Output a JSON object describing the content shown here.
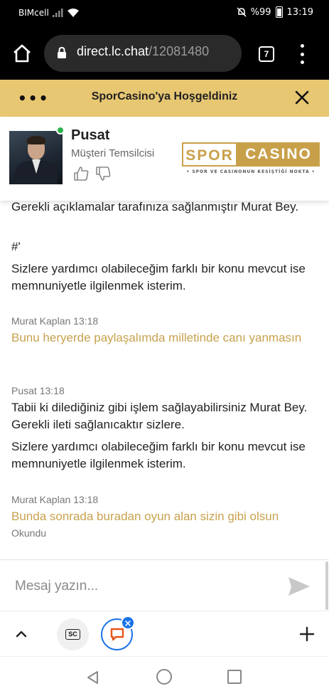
{
  "status_bar": {
    "carrier": "BIMcell",
    "battery": "%99",
    "time": "13:19",
    "icons": [
      "signal-icon",
      "wifi-icon",
      "mute-icon",
      "battery-icon"
    ]
  },
  "browser": {
    "url_host": "direct.lc.chat",
    "url_path": "/12081480",
    "tab_count": "7",
    "icons": [
      "home-icon",
      "lock-icon",
      "overflow-menu-icon"
    ]
  },
  "chat_header": {
    "more_label": "•••",
    "title": "SporCasino'ya Hoşgeldiniz",
    "accent_color": "#e8c773"
  },
  "agent": {
    "name": "Pusat",
    "role": "Müşteri Temsilcisi",
    "status_color": "#2bb24c"
  },
  "brand": {
    "word1": "SPOR",
    "word2": "CASINO",
    "tagline": "• SPOR VE CASINONUN KESİŞTİĞİ NOKTA •",
    "color": "#c9a04a"
  },
  "messages": [
    {
      "kind": "text",
      "text": "Gerekli açıklamalar tarafınıza sağlanmıştır Murat Bey."
    },
    {
      "kind": "text",
      "text": "#'"
    },
    {
      "kind": "text",
      "text": "Sizlere yardımcı olabileceğim farklı bir konu mevcut ise memnuniyetle ilgilenmek isterim."
    },
    {
      "kind": "meta",
      "text": "Murat Kaplan 13:18"
    },
    {
      "kind": "visitor",
      "text": "Bunu heryerde paylaşalımda milletinde canı yanmasın"
    },
    {
      "kind": "meta",
      "text": "Pusat 13:18"
    },
    {
      "kind": "text",
      "text": "Tabii ki dilediğiniz gibi işlem sağlayabilirsiniz Murat Bey. Gerekli ileti sağlanıcaktır sizlere."
    },
    {
      "kind": "text",
      "text": "Sizlere yardımcı olabileceğim farklı bir konu mevcut ise memnuniyetle ilgilenmek isterim."
    },
    {
      "kind": "meta",
      "text": "Murat Kaplan 13:18"
    },
    {
      "kind": "visitor",
      "text": "Bunda sonrada buradan oyun alan sizin gibi olsun"
    },
    {
      "kind": "status",
      "text": "Okundu"
    }
  ],
  "composer": {
    "placeholder": "Mesaj yazın..."
  },
  "bottom_toolbar": {
    "sc_favicon_text": "SC",
    "badge_symbol": "×"
  }
}
